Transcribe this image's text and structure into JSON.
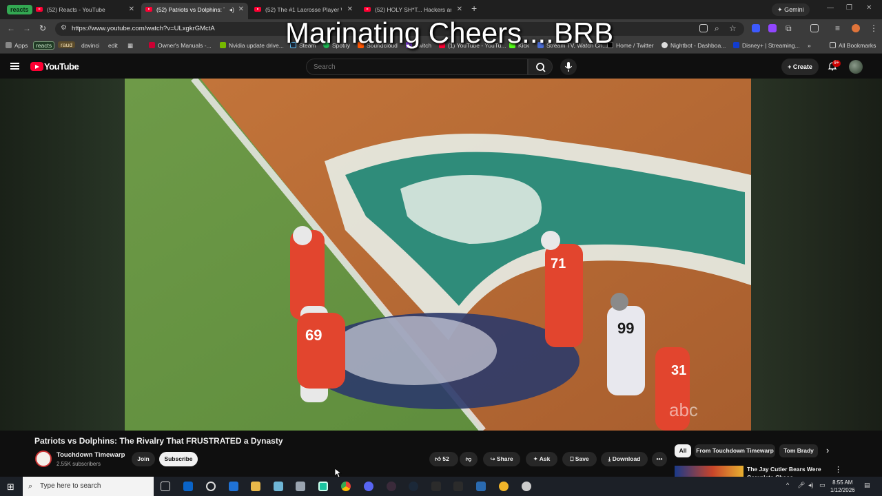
{
  "browser": {
    "tab_group_label": "reacts",
    "tabs": [
      {
        "title": "(52) Reacts - YouTube",
        "active": false
      },
      {
        "title": "(52) Patriots vs Dolphins: Th",
        "active": true
      },
      {
        "title": "(52) The #1 Lacrosse Player Wh",
        "active": false
      },
      {
        "title": "(52) HOLY SH*T... Hackers are u",
        "active": false
      }
    ],
    "gemini_label": "Gemini",
    "url": "https://www.youtube.com/watch?v=ULxgkrGMctA",
    "bookmarks": [
      "Apps",
      "reacts",
      "raud",
      "davinci",
      "edit",
      "Owner's Manuals -...",
      "Nvidia update drive...",
      "Steam",
      "Spotify",
      "Soundcloud",
      "Twitch",
      "(1) YouTube - YouTu...",
      "Kick",
      "Stream TV, Watch Ch...",
      "Home / Twitter",
      "Nightbot - Dashboa...",
      "Disney+ | Streaming...",
      "All Bookmarks"
    ]
  },
  "overlay_text": "Marinating Cheers....BRB",
  "youtube": {
    "logo_text": "YouTube",
    "search_placeholder": "Search",
    "create_label": "Create",
    "notif_badge": "9+",
    "video_title": "Patriots vs Dolphins: The Rivalry That FRUSTRATED a Dynasty",
    "channel_name": "Touchdown Timewarp",
    "channel_subs": "2.55K subscribers",
    "join_label": "Join",
    "subscribe_label": "Subscribe",
    "like_count": "52",
    "share_label": "Share",
    "ask_label": "Ask",
    "save_label": "Save",
    "download_label": "Download",
    "chips": [
      "All",
      "From Touchdown Timewarp",
      "Tom Brady"
    ],
    "suggested_title": "The Jay Cutler Bears Were Complete Chaos",
    "video_watermark": "abc",
    "jerseys": [
      "69",
      "71",
      "99",
      "31"
    ]
  },
  "taskbar": {
    "search_placeholder": "Type here to search",
    "time": "8:55 AM",
    "date": "1/12/2026"
  },
  "colors": {
    "youtube_red": "#ff0033",
    "page_bg": "#0f0f0f",
    "tab_group_green": "#33a852"
  }
}
